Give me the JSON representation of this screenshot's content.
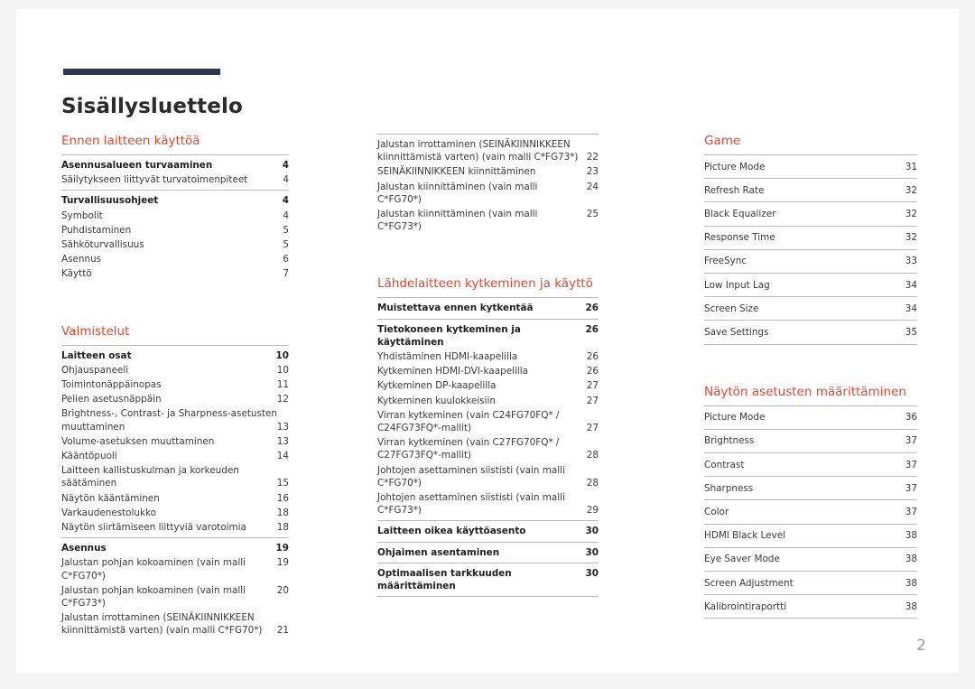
{
  "document": {
    "title": "Sisällysluettelo",
    "page_number": "2",
    "accent_color": "#e8452a",
    "rule_color": "#2e3752"
  },
  "columns": [
    {
      "name": "column-1",
      "sections": [
        {
          "heading": "Ennen laitteen käyttöä",
          "groups": [
            {
              "entries": [
                {
                  "label": "Asennusalueen turvaaminen",
                  "page": "4",
                  "bold": true
                },
                {
                  "label": "Säilytykseen liittyvät turvatoimenpiteet",
                  "page": "4",
                  "bold": false
                }
              ]
            },
            {
              "entries": [
                {
                  "label": "Turvallisuusohjeet",
                  "page": "4",
                  "bold": true
                },
                {
                  "label": "Symbolit",
                  "page": "4",
                  "bold": false
                },
                {
                  "label": "Puhdistaminen",
                  "page": "5",
                  "bold": false
                },
                {
                  "label": "Sähköturvallisuus",
                  "page": "5",
                  "bold": false
                },
                {
                  "label": "Asennus",
                  "page": "6",
                  "bold": false
                },
                {
                  "label": "Käyttö",
                  "page": "7",
                  "bold": false
                }
              ]
            }
          ]
        },
        {
          "heading": "Valmistelut",
          "groups": [
            {
              "entries": [
                {
                  "label": "Laitteen osat",
                  "page": "10",
                  "bold": true
                },
                {
                  "label": "Ohjauspaneeli",
                  "page": "10",
                  "bold": false
                },
                {
                  "label": "Toimintonäppäinopas",
                  "page": "11",
                  "bold": false
                },
                {
                  "label": "Pelien asetusnäppäin",
                  "page": "12",
                  "bold": false
                },
                {
                  "label": "Brightness-, Contrast- ja Sharpness-asetusten muuttaminen",
                  "page": "13",
                  "bold": false,
                  "wrap": true
                },
                {
                  "label": "Volume-asetuksen muuttaminen",
                  "page": "13",
                  "bold": false
                },
                {
                  "label": "Kääntöpuoli",
                  "page": "14",
                  "bold": false
                },
                {
                  "label": "Laitteen kallistuskulman ja korkeuden säätäminen",
                  "page": "15",
                  "bold": false,
                  "wrap": true
                },
                {
                  "label": "Näytön kääntäminen",
                  "page": "16",
                  "bold": false
                },
                {
                  "label": "Varkaudenestolukko",
                  "page": "18",
                  "bold": false
                },
                {
                  "label": "Näytön siirtämiseen liittyviä varotoimia",
                  "page": "18",
                  "bold": false
                }
              ]
            },
            {
              "entries": [
                {
                  "label": "Asennus",
                  "page": "19",
                  "bold": true
                },
                {
                  "label": "Jalustan pohjan kokoaminen (vain malli C*FG70*)",
                  "page": "19",
                  "bold": false,
                  "inline": true
                },
                {
                  "label": "Jalustan pohjan kokoaminen (vain malli C*FG73*)",
                  "page": "20",
                  "bold": false,
                  "inline": true
                },
                {
                  "label": "Jalustan irrottaminen (SEINÄKIINNIKKEEN kiinnittämistä varten) (vain malli C*FG70*)",
                  "page": "21",
                  "bold": false,
                  "wrap": true
                }
              ]
            }
          ]
        }
      ]
    },
    {
      "name": "column-2",
      "sections": [
        {
          "heading": "",
          "groups": [
            {
              "entries": [
                {
                  "label": "Jalustan irrottaminen (SEINÄKIINNIKKEEN kiinnittämistä varten) (vain malli C*FG73*)",
                  "page": "22",
                  "bold": false,
                  "wrap": true
                },
                {
                  "label": "SEINÄKIINNIKKEEN kiinnittäminen",
                  "page": "23",
                  "bold": false
                },
                {
                  "label": "Jalustan kiinnittäminen (vain malli C*FG70*)",
                  "page": "24",
                  "bold": false
                },
                {
                  "label": "Jalustan kiinnittäminen (vain malli C*FG73*)",
                  "page": "25",
                  "bold": false
                }
              ]
            }
          ]
        },
        {
          "heading": "Lähdelaitteen kytkeminen ja käyttö",
          "groups": [
            {
              "entries": [
                {
                  "label": "Muistettava ennen kytkentää",
                  "page": "26",
                  "bold": true
                }
              ]
            },
            {
              "entries": [
                {
                  "label": "Tietokoneen kytkeminen ja käyttäminen",
                  "page": "26",
                  "bold": true
                },
                {
                  "label": "Yhdistäminen HDMI-kaapelilla",
                  "page": "26",
                  "bold": false
                },
                {
                  "label": "Kytkeminen HDMI-DVI-kaapelilla",
                  "page": "26",
                  "bold": false
                },
                {
                  "label": "Kytkeminen DP-kaapelilla",
                  "page": "27",
                  "bold": false
                },
                {
                  "label": "Kytkeminen kuulokkeisiin",
                  "page": "27",
                  "bold": false
                },
                {
                  "label": "Virran kytkeminen (vain C24FG70FQ* / C24FG73FQ*-mallit)",
                  "page": "27",
                  "bold": false,
                  "wrap": true
                },
                {
                  "label": "Virran kytkeminen (vain C27FG70FQ* / C27FG73FQ*-mallit)",
                  "page": "28",
                  "bold": false,
                  "wrap": true
                },
                {
                  "label": "Johtojen asettaminen siististi (vain malli C*FG70*)",
                  "page": "28",
                  "bold": false,
                  "wrap": true
                },
                {
                  "label": "Johtojen asettaminen siististi (vain malli C*FG73*)",
                  "page": "29",
                  "bold": false,
                  "wrap": true
                }
              ]
            },
            {
              "entries": [
                {
                  "label": "Laitteen oikea käyttöasento",
                  "page": "30",
                  "bold": true
                }
              ]
            },
            {
              "entries": [
                {
                  "label": "Ohjaimen asentaminen",
                  "page": "30",
                  "bold": true
                }
              ]
            },
            {
              "entries": [
                {
                  "label": "Optimaalisen tarkkuuden määrittäminen",
                  "page": "30",
                  "bold": true
                }
              ]
            }
          ]
        }
      ]
    },
    {
      "name": "column-3",
      "sections": [
        {
          "heading": "Game",
          "ruled": true,
          "entries": [
            {
              "label": "Picture Mode",
              "page": "31"
            },
            {
              "label": "Refresh Rate",
              "page": "32"
            },
            {
              "label": "Black Equalizer",
              "page": "32"
            },
            {
              "label": "Response Time",
              "page": "32"
            },
            {
              "label": "FreeSync",
              "page": "33"
            },
            {
              "label": "Low Input Lag",
              "page": "34"
            },
            {
              "label": "Screen Size",
              "page": "34"
            },
            {
              "label": "Save Settings",
              "page": "35"
            }
          ]
        },
        {
          "heading": "Näytön asetusten määrittäminen",
          "ruled": true,
          "entries": [
            {
              "label": "Picture Mode",
              "page": "36"
            },
            {
              "label": "Brightness",
              "page": "37"
            },
            {
              "label": "Contrast",
              "page": "37"
            },
            {
              "label": "Sharpness",
              "page": "37"
            },
            {
              "label": "Color",
              "page": "37"
            },
            {
              "label": "HDMI Black Level",
              "page": "38"
            },
            {
              "label": "Eye Saver Mode",
              "page": "38"
            },
            {
              "label": "Screen Adjustment",
              "page": "38"
            },
            {
              "label": "Kalibrointiraportti",
              "page": "38"
            }
          ]
        }
      ]
    }
  ]
}
